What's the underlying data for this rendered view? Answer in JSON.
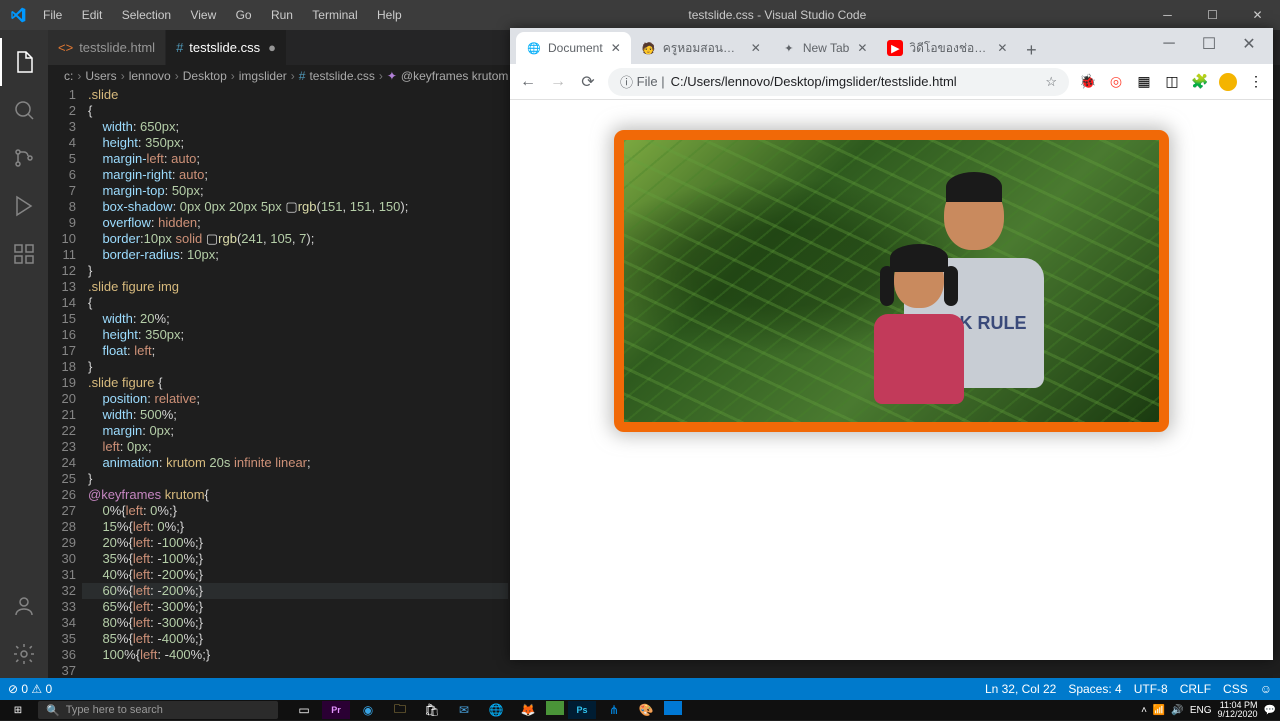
{
  "title": "testslide.css - Visual Studio Code",
  "menu": [
    "File",
    "Edit",
    "Selection",
    "View",
    "Go",
    "Run",
    "Terminal",
    "Help"
  ],
  "tabs": [
    {
      "label": "testslide.html",
      "icon": "<>",
      "active": false
    },
    {
      "label": "testslide.css",
      "icon": "#",
      "active": true,
      "dirty": true
    }
  ],
  "breadcrumb": [
    "c:",
    "Users",
    "lennovo",
    "Desktop",
    "imgslider",
    "testslide.css",
    "@keyframes krutom"
  ],
  "code_lines": [
    ".slide",
    "{",
    "    width: 650px;",
    "    height: 350px;",
    "    margin-left: auto;",
    "    margin-right: auto;",
    "    margin-top: 50px;",
    "    box-shadow: 0px 0px 20px 5px ▢rgb(151, 151, 150);",
    "    overflow: hidden;",
    "    border:10px solid ▢rgb(241, 105, 7);",
    "    border-radius: 10px;",
    "}",
    ".slide figure img",
    "{",
    "    width: 20%;",
    "    height: 350px;",
    "    float: left;",
    "}",
    ".slide figure {",
    "    position: relative;",
    "    width: 500%;",
    "    margin: 0px;",
    "    left: 0px;",
    "    animation: krutom 20s infinite linear;",
    "}",
    "@keyframes krutom{",
    "    0%{left: 0%;}",
    "    15%{left: 0%;}",
    "    20%{left: -100%;}",
    "    35%{left: -100%;}",
    "    40%{left: -200%;}",
    "    60%{left: -200%;}",
    "    65%{left: -300%;}",
    "    80%{left: -300%;}",
    "    85%{left: -400%;}",
    "    100%{left: -400%;}",
    "",
    ""
  ],
  "active_line": 32,
  "status": {
    "left": "⊘ 0 ⚠ 0",
    "right": [
      "Ln 32, Col 22",
      "Spaces: 4",
      "UTF-8",
      "CRLF",
      "CSS",
      "☺"
    ]
  },
  "taskbar": {
    "search_placeholder": "Type here to search",
    "clock": "11:04 PM",
    "date": "9/12/2020",
    "lang": "ENG"
  },
  "chrome": {
    "tabs": [
      {
        "label": "Document",
        "fav": "◌",
        "active": true
      },
      {
        "label": "ครูหอมสอนคอมพิวเตอร์",
        "fav": "🧑",
        "active": false
      },
      {
        "label": "New Tab",
        "fav": "✦",
        "active": false
      },
      {
        "label": "วิดีโอของช่อง - YouTu",
        "fav": "▶",
        "active": false
      }
    ],
    "url_prefix": "File |",
    "url": "C:/Users/lennovo/Desktop/imgslider/testslide.html",
    "shirt_text": "REAK RULE"
  }
}
